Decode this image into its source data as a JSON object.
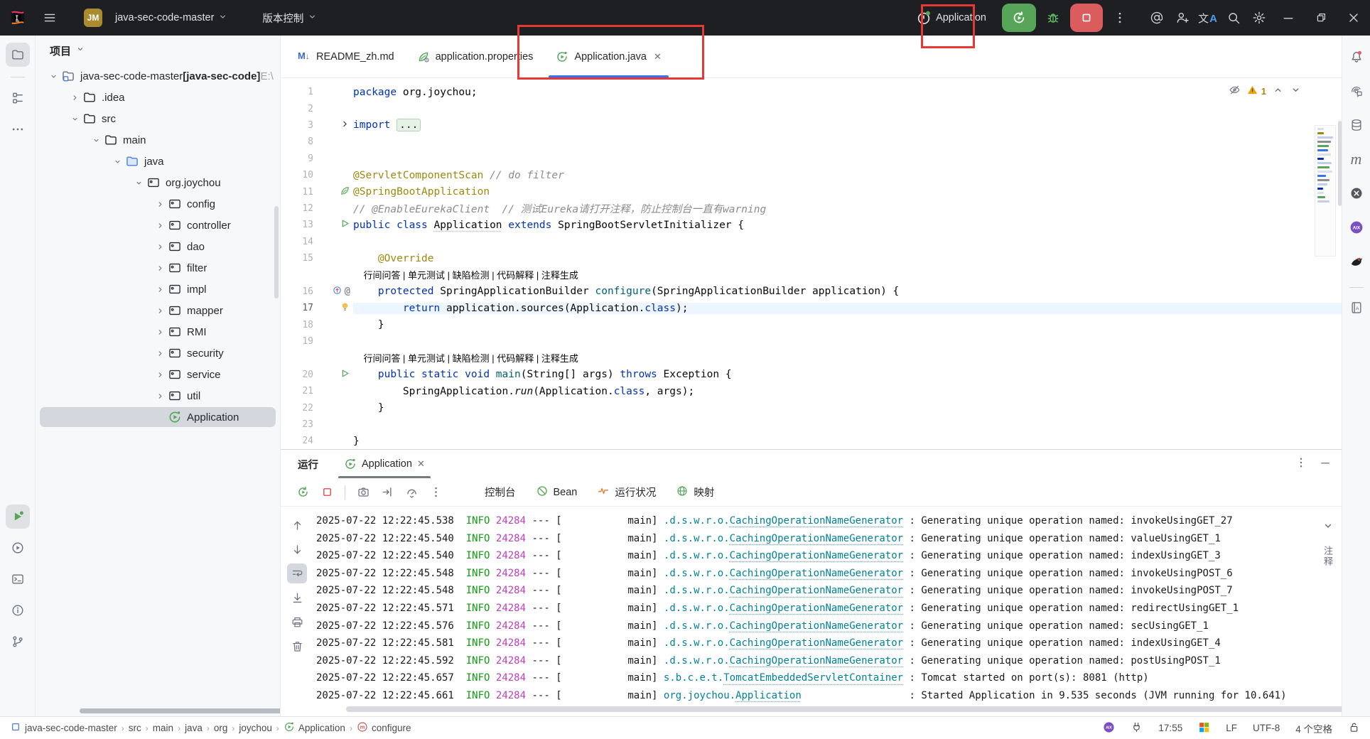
{
  "colors": {
    "accent": "#3574F0",
    "annotation_red": "#E53935",
    "run_green": "#57A558",
    "stop_red": "#DB5C5C"
  },
  "window": {
    "badge": "JM",
    "project": "java-sec-code-master",
    "vcs": "版本控制",
    "run_config": "Application"
  },
  "title_icons_right": [
    "at",
    "user-plus",
    "translate",
    "search",
    "gear"
  ],
  "tabs": [
    {
      "label": "README_zh.md",
      "icon": "markdown",
      "active": false
    },
    {
      "label": "application.properties",
      "icon": "spring-config",
      "active": false
    },
    {
      "label": "Application.java",
      "icon": "spring-boot",
      "active": true,
      "close": "✕"
    }
  ],
  "left_stripe": {
    "top": [
      "project",
      "structure",
      "more"
    ],
    "bottom": [
      "run-active",
      "services",
      "terminal",
      "problems",
      "git-branch"
    ]
  },
  "right_stripe": [
    "notifications",
    "ai-assistant",
    "database",
    "maven",
    "circle-x",
    "aix",
    "bird",
    "divider",
    "documentation"
  ],
  "project_panel": {
    "title": "项目",
    "tree": [
      {
        "label": "java-sec-code-master",
        "bold_suffix": " [java-sec-code]",
        "gray_suffix": " E:\\",
        "icon": "project-root",
        "indent": 0,
        "state": "expanded"
      },
      {
        "label": ".idea",
        "icon": "folder",
        "indent": 1,
        "state": "collapsed"
      },
      {
        "label": "src",
        "icon": "folder",
        "indent": 1,
        "state": "expanded"
      },
      {
        "label": "main",
        "icon": "folder",
        "indent": 2,
        "state": "expanded"
      },
      {
        "label": "java",
        "icon": "folder-src",
        "indent": 3,
        "state": "expanded"
      },
      {
        "label": "org.joychou",
        "icon": "package",
        "indent": 4,
        "state": "expanded"
      },
      {
        "label": "config",
        "icon": "package",
        "indent": 5,
        "state": "collapsed"
      },
      {
        "label": "controller",
        "icon": "package",
        "indent": 5,
        "state": "collapsed"
      },
      {
        "label": "dao",
        "icon": "package",
        "indent": 5,
        "state": "collapsed"
      },
      {
        "label": "filter",
        "icon": "package",
        "indent": 5,
        "state": "collapsed"
      },
      {
        "label": "impl",
        "icon": "package",
        "indent": 5,
        "state": "collapsed"
      },
      {
        "label": "mapper",
        "icon": "package",
        "indent": 5,
        "state": "collapsed"
      },
      {
        "label": "RMI",
        "icon": "package",
        "indent": 5,
        "state": "collapsed"
      },
      {
        "label": "security",
        "icon": "package",
        "indent": 5,
        "state": "collapsed"
      },
      {
        "label": "service",
        "icon": "package",
        "indent": 5,
        "state": "collapsed"
      },
      {
        "label": "util",
        "icon": "package",
        "indent": 5,
        "state": "collapsed"
      },
      {
        "label": "Application",
        "icon": "spring-boot",
        "indent": 5,
        "state": "leaf",
        "selected": true
      }
    ]
  },
  "editor": {
    "inspections": {
      "warnings": "1"
    },
    "lines": [
      {
        "n": "1",
        "seg": [
          [
            "package",
            "kw"
          ],
          [
            " org.joychou;",
            "pl"
          ]
        ]
      },
      {
        "n": "2",
        "seg": []
      },
      {
        "n": "3",
        "fold": true,
        "seg": [
          [
            "import ",
            "kw"
          ],
          [
            "...",
            "foldbox"
          ]
        ]
      },
      {
        "n": "8",
        "seg": []
      },
      {
        "n": "9",
        "seg": []
      },
      {
        "n": "10",
        "seg": [
          [
            "@ServletComponentScan ",
            "an"
          ],
          [
            "// do filter",
            "cm"
          ]
        ]
      },
      {
        "n": "11",
        "gutter": "spring",
        "seg": [
          [
            "@SpringBootApplication",
            "an"
          ]
        ]
      },
      {
        "n": "12",
        "seg": [
          [
            "// @EnableEurekaClient  // 测试Eureka请打开注释，防止控制台一直有warning",
            "cm"
          ]
        ]
      },
      {
        "n": "13",
        "gutter": "run",
        "seg": [
          [
            "public class ",
            "kw"
          ],
          [
            "Application",
            "cls"
          ],
          [
            " ",
            "pl"
          ],
          [
            "extends",
            "kw"
          ],
          [
            " SpringBootServletInitializer {",
            "pl"
          ]
        ]
      },
      {
        "n": "14",
        "seg": []
      },
      {
        "n": "15",
        "seg": [
          [
            "    ",
            "pl"
          ],
          [
            "@Override",
            "an"
          ]
        ]
      },
      {
        "inlay": "行间问答 | 单元测试 | 缺陷检测 | 代码解释 | 注释生成"
      },
      {
        "n": "16",
        "gutter": "override",
        "seg": [
          [
            "    ",
            "pl"
          ],
          [
            "protected",
            "kw"
          ],
          [
            " SpringApplicationBuilder ",
            "pl"
          ],
          [
            "configure",
            "me"
          ],
          [
            "(SpringApplicationBuilder application) {",
            "pl"
          ]
        ]
      },
      {
        "n": "17",
        "gutter": "bulb",
        "hl": true,
        "seg": [
          [
            "        ",
            "pl"
          ],
          [
            "return",
            "kw"
          ],
          [
            " application.sources(Application.",
            "pl"
          ],
          [
            "class",
            "kw"
          ],
          [
            ");",
            "pl"
          ]
        ]
      },
      {
        "n": "18",
        "seg": [
          [
            "    }",
            "pl"
          ]
        ]
      },
      {
        "n": "19",
        "seg": []
      },
      {
        "inlay": "行间问答 | 单元测试 | 缺陷检测 | 代码解释 | 注释生成"
      },
      {
        "n": "20",
        "gutter": "run",
        "seg": [
          [
            "    ",
            "pl"
          ],
          [
            "public static void ",
            "kw"
          ],
          [
            "main",
            "me"
          ],
          [
            "(String[] args) ",
            "pl"
          ],
          [
            "throws",
            "kw"
          ],
          [
            " Exception {",
            "pl"
          ]
        ]
      },
      {
        "n": "21",
        "seg": [
          [
            "        SpringApplication.",
            "pl"
          ],
          [
            "run",
            "itm"
          ],
          [
            "(Application.",
            "pl"
          ],
          [
            "class",
            "kw"
          ],
          [
            ", args);",
            "pl"
          ]
        ]
      },
      {
        "n": "22",
        "seg": [
          [
            "    }",
            "pl"
          ]
        ]
      },
      {
        "n": "23",
        "seg": []
      },
      {
        "n": "24",
        "seg": [
          [
            "}",
            "pl"
          ]
        ]
      }
    ]
  },
  "run_panel": {
    "label": "运行",
    "tab": "Application",
    "toolbar": [
      "rerun",
      "stop",
      "divider",
      "camera",
      "attach",
      "gauge",
      "kebab"
    ],
    "console_ltb": [
      "arrow-up",
      "arrow-down",
      "soft-wrap",
      "scroll-end",
      "print",
      "trash"
    ],
    "console_tabs": [
      {
        "label": "控制台",
        "icon": null,
        "active": true
      },
      {
        "label": "Bean",
        "icon": "bean"
      },
      {
        "label": "运行状况",
        "icon": "health"
      },
      {
        "label": "映射",
        "icon": "mapping"
      }
    ],
    "side_label": "注释",
    "logs": [
      {
        "time": "2025-07-22 12:22:45.538",
        "level": "INFO",
        "pid": "24284",
        "thread": "main",
        "logger_prefix": ".d.s.w.r.o.",
        "logger_link": "CachingOperationNameGenerator",
        "msg": "Generating unique operation named: invokeUsingGET_27"
      },
      {
        "time": "2025-07-22 12:22:45.540",
        "level": "INFO",
        "pid": "24284",
        "thread": "main",
        "logger_prefix": ".d.s.w.r.o.",
        "logger_link": "CachingOperationNameGenerator",
        "msg": "Generating unique operation named: valueUsingGET_1"
      },
      {
        "time": "2025-07-22 12:22:45.540",
        "level": "INFO",
        "pid": "24284",
        "thread": "main",
        "logger_prefix": ".d.s.w.r.o.",
        "logger_link": "CachingOperationNameGenerator",
        "msg": "Generating unique operation named: indexUsingGET_3"
      },
      {
        "time": "2025-07-22 12:22:45.548",
        "level": "INFO",
        "pid": "24284",
        "thread": "main",
        "logger_prefix": ".d.s.w.r.o.",
        "logger_link": "CachingOperationNameGenerator",
        "msg": "Generating unique operation named: invokeUsingPOST_6"
      },
      {
        "time": "2025-07-22 12:22:45.548",
        "level": "INFO",
        "pid": "24284",
        "thread": "main",
        "logger_prefix": ".d.s.w.r.o.",
        "logger_link": "CachingOperationNameGenerator",
        "msg": "Generating unique operation named: invokeUsingPOST_7"
      },
      {
        "time": "2025-07-22 12:22:45.571",
        "level": "INFO",
        "pid": "24284",
        "thread": "main",
        "logger_prefix": ".d.s.w.r.o.",
        "logger_link": "CachingOperationNameGenerator",
        "msg": "Generating unique operation named: redirectUsingGET_1"
      },
      {
        "time": "2025-07-22 12:22:45.576",
        "level": "INFO",
        "pid": "24284",
        "thread": "main",
        "logger_prefix": ".d.s.w.r.o.",
        "logger_link": "CachingOperationNameGenerator",
        "msg": "Generating unique operation named: secUsingGET_1"
      },
      {
        "time": "2025-07-22 12:22:45.581",
        "level": "INFO",
        "pid": "24284",
        "thread": "main",
        "logger_prefix": ".d.s.w.r.o.",
        "logger_link": "CachingOperationNameGenerator",
        "msg": "Generating unique operation named: indexUsingGET_4"
      },
      {
        "time": "2025-07-22 12:22:45.592",
        "level": "INFO",
        "pid": "24284",
        "thread": "main",
        "logger_prefix": ".d.s.w.r.o.",
        "logger_link": "CachingOperationNameGenerator",
        "msg": "Generating unique operation named: postUsingPOST_1"
      },
      {
        "time": "2025-07-22 12:22:45.657",
        "level": "INFO",
        "pid": "24284",
        "thread": "main",
        "logger_prefix": "s.b.c.e.t.",
        "logger_link": "TomcatEmbeddedServletContainer",
        "msg": "Tomcat started on port(s): 8081 (http)"
      },
      {
        "time": "2025-07-22 12:22:45.661",
        "level": "INFO",
        "pid": "24284",
        "thread": "main",
        "logger_prefix": "org.joychou.",
        "logger_link": "Application",
        "msg": "Started Application in 9.535 seconds (JVM running for 10.641)"
      }
    ]
  },
  "status_bar": {
    "breadcrumbs": [
      "java-sec-code-master",
      "src",
      "main",
      "java",
      "org",
      "joychou",
      "Application",
      "configure"
    ],
    "time": "17:55",
    "line_sep": "LF",
    "encoding": "UTF-8",
    "indent": "4 个空格"
  }
}
